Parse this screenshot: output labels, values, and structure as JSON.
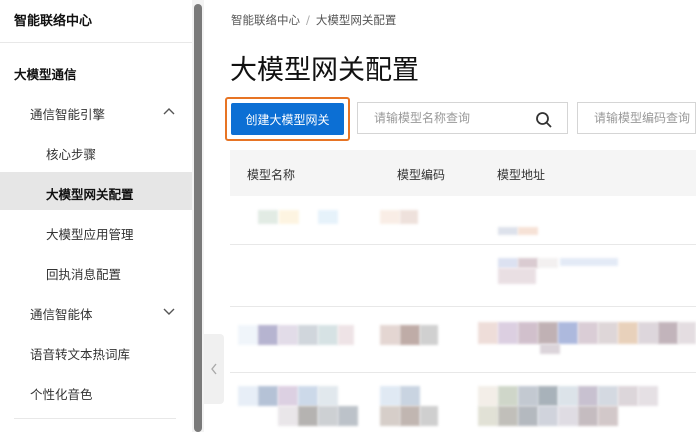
{
  "sidebar": {
    "title": "智能联络中心",
    "items": [
      {
        "label": "大模型通信"
      },
      {
        "label": "通信智能引擎"
      },
      {
        "label": "核心步骤"
      },
      {
        "label": "大模型网关配置"
      },
      {
        "label": "大模型应用管理"
      },
      {
        "label": "回执消息配置"
      },
      {
        "label": "通信智能体"
      },
      {
        "label": "语音转文本热词库"
      },
      {
        "label": "个性化音色"
      }
    ]
  },
  "breadcrumb": {
    "root": "智能联络中心",
    "separator": "/",
    "current": "大模型网关配置"
  },
  "page": {
    "title": "大模型网关配置"
  },
  "toolbar": {
    "create_label": "创建大模型网关",
    "search_name_placeholder": "请输模型名称查询",
    "search_code_placeholder": "请输模型编码查询"
  },
  "table": {
    "columns": [
      "模型名称",
      "模型编码",
      "模型地址"
    ]
  },
  "colors": {
    "primary": "#0c6fd4",
    "highlight_border": "#e77424"
  },
  "icons": {
    "search": "search-icon",
    "chevron_up": "chevron-up-icon",
    "chevron_down": "chevron-down-icon",
    "collapse": "chevron-left-icon"
  }
}
